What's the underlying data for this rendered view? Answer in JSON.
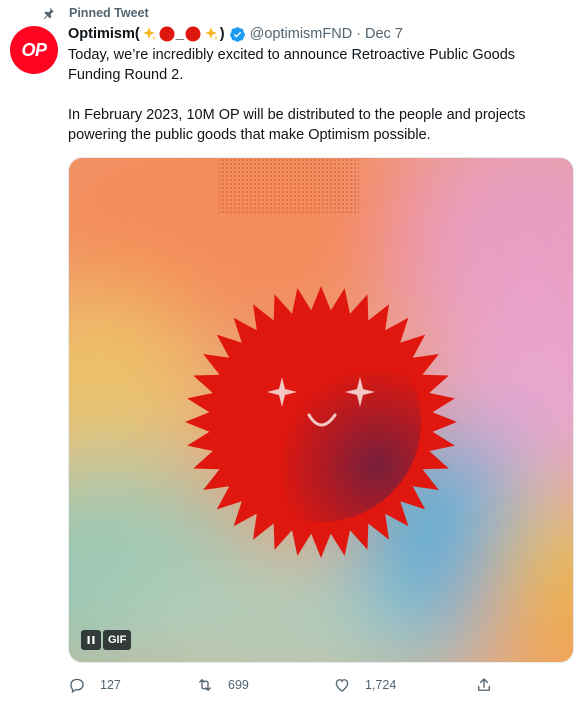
{
  "pinned": {
    "label": "Pinned Tweet"
  },
  "author": {
    "avatar_text": "OP",
    "display_name": "Optimism",
    "name_decoration_open": " (",
    "name_decoration_sep": "_",
    "name_decoration_close": ")",
    "handle": "@optimismFND",
    "separator": "·",
    "date": "Dec 7"
  },
  "tweet": {
    "paragraph1": "Today, we’re incredibly excited to announce Retroactive Public Goods Funding Round 2.",
    "paragraph2": "In February 2023, 10M OP will be distributed to the people and projects powering the public goods that make Optimism possible."
  },
  "media": {
    "gif_label": "GIF",
    "pause_icon": "pause-icon"
  },
  "actions": {
    "replies": "127",
    "retweets": "699",
    "likes": "1,724"
  },
  "colors": {
    "brand_red": "#ff0420",
    "verified_blue": "#1d9bf0",
    "secondary_text": "#536471"
  }
}
